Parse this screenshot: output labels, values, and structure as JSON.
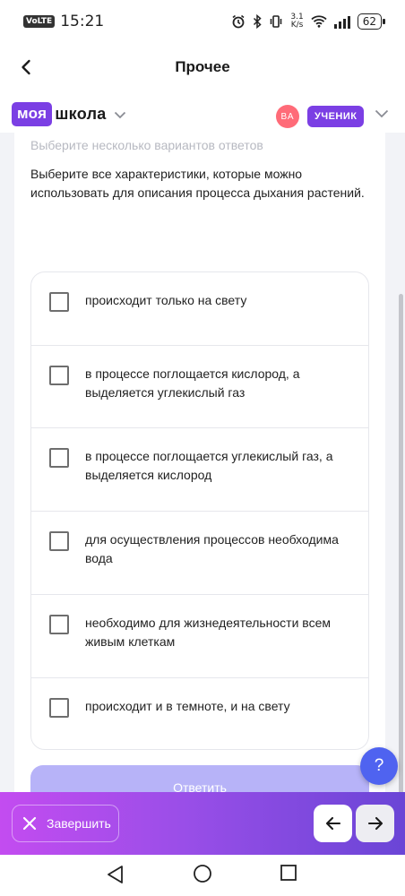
{
  "status_bar": {
    "volte": "VoLTE",
    "time": "15:21",
    "net_speed_value": "3.1",
    "net_speed_unit": "K/s",
    "battery": "62"
  },
  "header": {
    "title": "Прочее"
  },
  "school_bar": {
    "logo_part1": "моя",
    "logo_part2": "школа",
    "avatar_initials": "ВА",
    "role": "УЧЕНИК"
  },
  "task": {
    "hint": "Выберите несколько вариантов ответов",
    "question": "Выберите все характеристики, которые можно использовать для описания процесса дыхания растений.",
    "options": [
      {
        "label": "происходит только на свету",
        "checked": false
      },
      {
        "label": "в процессе поглощается кислород, а выделяется углекислый газ",
        "checked": false
      },
      {
        "label": "в процессе поглощается углекислый газ, а выделяется кислород",
        "checked": false
      },
      {
        "label": "для осуществления процессов необходима вода",
        "checked": false
      },
      {
        "label": "необходимо для жизнедеятельности всем живым клеткам",
        "checked": false
      },
      {
        "label": "происходит и в темноте, и на свету",
        "checked": false
      }
    ],
    "answer_button": "Ответить"
  },
  "help_button": "?",
  "bottom_bar": {
    "finish_label": "Завершить"
  },
  "colors": {
    "brand_purple": "#7b3fe4",
    "avatar_pink": "#ff6b78",
    "answer_button": "#b7b3f8",
    "help_fab": "#4f63f0",
    "bottom_gradient_start": "#c34cf0",
    "bottom_gradient_end": "#6a45d6"
  },
  "icons": {
    "back": "arrow-left-icon",
    "logo_dropdown": "chevron-down-icon",
    "role_dropdown": "chevron-down-icon",
    "finish": "close-icon",
    "prev": "arrow-left-icon",
    "next": "arrow-right-icon"
  }
}
